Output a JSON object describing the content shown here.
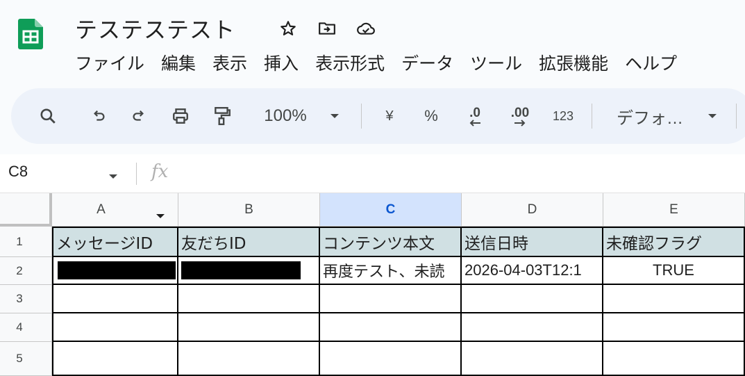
{
  "doc": {
    "title": "テステステスト"
  },
  "menu": [
    "ファイル",
    "編集",
    "表示",
    "挿入",
    "表示形式",
    "データ",
    "ツール",
    "拡張機能",
    "ヘルプ"
  ],
  "toolbar": {
    "zoom": "100%",
    "currency": "¥",
    "percent": "%",
    "dec_decrease": ".0",
    "dec_increase": ".00",
    "number_format": "123",
    "font": "デフォ…"
  },
  "formula_bar": {
    "cell_ref": "C8",
    "fx": "fx",
    "value": ""
  },
  "sheet": {
    "columns": [
      "A",
      "B",
      "C",
      "D",
      "E"
    ],
    "selected_column": "C",
    "rows": [
      "1",
      "2",
      "3",
      "4",
      "5"
    ],
    "header_row": [
      "メッセージID",
      "友だちID",
      "コンテンツ本文",
      "送信日時",
      "未確認フラグ"
    ],
    "row2": [
      "",
      "",
      "再度テスト、未読",
      "2026-04-03T12:1",
      "TRUE"
    ]
  },
  "colors": {
    "accent": "#0b57d0",
    "header_fill": "#d0e0e3",
    "selected_col": "#d3e3fd",
    "sheets_green": "#0f9d58"
  }
}
